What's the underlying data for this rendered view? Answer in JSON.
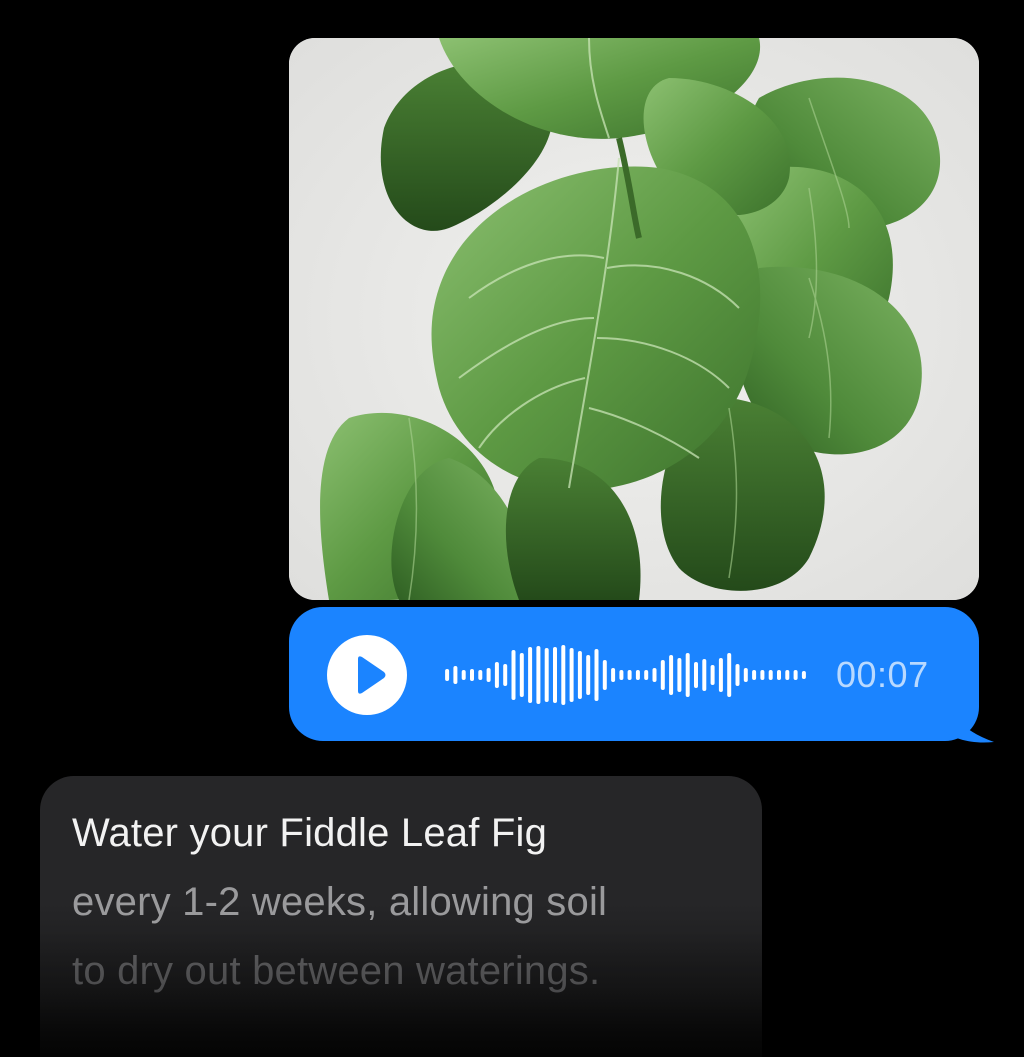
{
  "conversation": {
    "photo_message": {
      "image_icon": "fiddle-leaf-fig-photo",
      "background_color": "#e9e9e7",
      "leaf_color": "#5f9a45"
    },
    "audio_message": {
      "play_icon": "play-icon",
      "waveform_icon": "waveform-icon",
      "duration": "00:07",
      "bubble_color": "#1b84ff"
    },
    "text_message": {
      "lines": [
        "Water your Fiddle Leaf Fig",
        "every 1-2 weeks, allowing soil",
        "to dry out between waterings."
      ],
      "bubble_color": "#262628"
    }
  }
}
